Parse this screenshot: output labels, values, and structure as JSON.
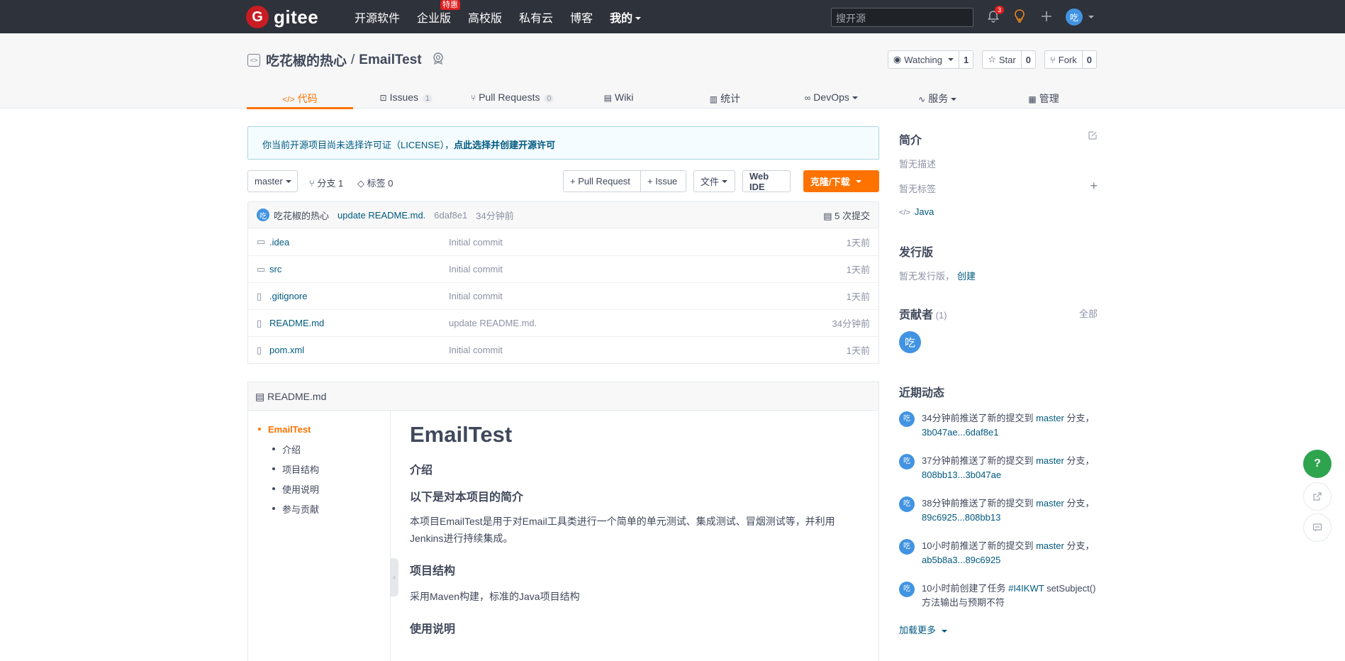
{
  "topnav": {
    "logo_mark": "G",
    "logo_text": "gitee",
    "links": [
      "开源软件",
      "企业版",
      "高校版",
      "私有云",
      "博客",
      "我的"
    ],
    "enterprise_badge": "特惠",
    "search_placeholder": "搜开源",
    "notification_count": "3",
    "avatar_char": "吃"
  },
  "project": {
    "owner": "吃花椒的热心",
    "separator": "/",
    "name": "EmailTest",
    "watch_label": "Watching",
    "watch_count": "1",
    "star_label": "Star",
    "star_count": "0",
    "fork_label": "Fork",
    "fork_count": "0"
  },
  "tabs": [
    {
      "label": "代码",
      "count": ""
    },
    {
      "label": "Issues",
      "count": "1"
    },
    {
      "label": "Pull Requests",
      "count": "0"
    },
    {
      "label": "Wiki",
      "count": ""
    },
    {
      "label": "统计",
      "count": ""
    },
    {
      "label": "DevOps",
      "count": ""
    },
    {
      "label": "服务",
      "count": ""
    },
    {
      "label": "管理",
      "count": ""
    }
  ],
  "license_notice": {
    "text": "你当前开源项目尚未选择许可证（LICENSE），",
    "link": "点此选择并创建开源许可"
  },
  "toolbar": {
    "branch": "master",
    "branches": "分支 1",
    "tags": "标签 0",
    "pull_request": "+ Pull Request",
    "issue": "+ Issue",
    "file": "文件",
    "web_ide": "Web IDE",
    "clone": "克隆/下载"
  },
  "commit": {
    "author": "吃花椒的热心",
    "message": "update README.md.",
    "hash": "6daf8e1",
    "time": "34分钟前",
    "total": "5 次提交"
  },
  "files": [
    {
      "name": ".idea",
      "type": "folder",
      "message": "Initial commit",
      "time": "1天前"
    },
    {
      "name": "src",
      "type": "folder",
      "message": "Initial commit",
      "time": "1天前"
    },
    {
      "name": ".gitignore",
      "type": "file",
      "message": "Initial commit",
      "time": "1天前"
    },
    {
      "name": "README.md",
      "type": "file",
      "message": "update README.md.",
      "time": "34分钟前"
    },
    {
      "name": "pom.xml",
      "type": "file",
      "message": "Initial commit",
      "time": "1天前"
    }
  ],
  "readme": {
    "filename": "README.md",
    "toc": [
      "EmailTest",
      "介绍",
      "项目结构",
      "使用说明",
      "参与贡献"
    ],
    "h1": "EmailTest",
    "intro_h": "介绍",
    "summary_h": "以下是对本项目的简介",
    "summary_p": "本项目EmailTest是用于对Email工具类进行一个简单的单元测试、集成测试、冒烟测试等，并利用Jenkins进行持续集成。",
    "structure_h": "项目结构",
    "structure_p": "采用Maven构建，标准的Java项目结构",
    "usage_h": "使用说明"
  },
  "sidebar": {
    "intro_title": "简介",
    "no_desc": "暂无描述",
    "no_tags": "暂无标签",
    "language": "Java",
    "release_title": "发行版",
    "no_release": "暂无发行版，",
    "create": "创建",
    "contributors_title": "贡献者",
    "contributors_count": "(1)",
    "all": "全部",
    "contributor_avatar": "吃",
    "activity_title": "近期动态",
    "activities": [
      {
        "prefix": "34分钟前推送了新的提交到",
        "branch": "master",
        "suffix": "分支，",
        "range": "3b047ae...6daf8e1"
      },
      {
        "prefix": "37分钟前推送了新的提交到",
        "branch": "master",
        "suffix": "分支，",
        "range": "808bb13...3b047ae"
      },
      {
        "prefix": "38分钟前推送了新的提交到",
        "branch": "master",
        "suffix": "分支，",
        "range": "89c6925...808bb13"
      },
      {
        "prefix": "10小时前推送了新的提交到",
        "branch": "master",
        "suffix": "分支，",
        "range": "ab5b8a3...89c6925"
      }
    ],
    "task_activity": {
      "prefix": "10小时前创建了任务",
      "link": "#I4IKWT",
      "text": "setSubject()方法输出与预期不符"
    },
    "load_more": "加载更多"
  },
  "floating": {
    "help": "?"
  }
}
